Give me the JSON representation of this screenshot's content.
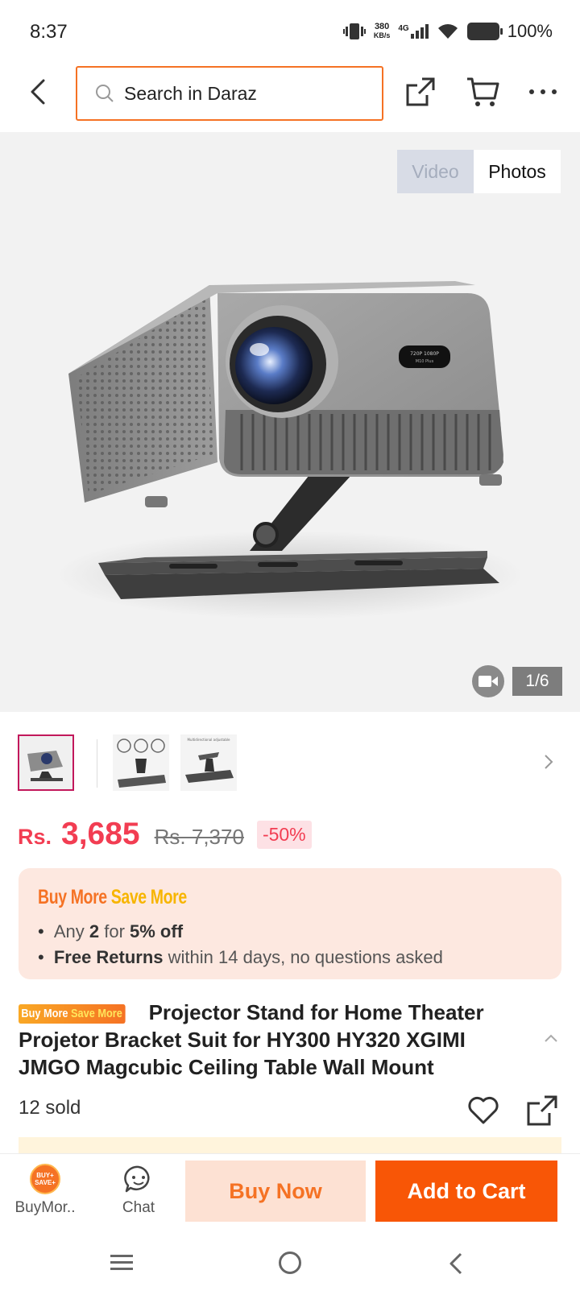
{
  "status_bar": {
    "time": "8:37",
    "net_speed_value": "380",
    "net_speed_unit": "KB/s",
    "network": "4G",
    "battery": "100%"
  },
  "topnav": {
    "search_placeholder": "Search in Daraz"
  },
  "gallery": {
    "tab_video": "Video",
    "tab_photos": "Photos",
    "counter": "1/6",
    "lens_label_line1": "720P 1080P",
    "lens_label_line2": "M10 Plus"
  },
  "thumbnails": {
    "thumb3_caption": "Multidirectional adjustable"
  },
  "price": {
    "currency": "Rs.",
    "current": "3,685",
    "original": "Rs. 7,370",
    "discount": "-50%"
  },
  "promo": {
    "title_buy": "Buy More",
    "title_save": "Save More",
    "line1_pre": "Any ",
    "line1_qty": "2",
    "line1_mid": " for ",
    "line1_off": "5% off",
    "line2_bold": "Free Returns",
    "line2_rest": " within 14 days, no questions asked"
  },
  "product": {
    "tag_buy": "Buy More",
    "tag_save": "Save More",
    "title": "Projector Stand for Home Theater Projetor Bracket Suit for HY300 HY320 XGIMI JMGO Magcubic Ceiling Table Wall Mount",
    "sold": "12 sold"
  },
  "bottom_bar": {
    "buymore_label": "BuyMor..",
    "coin_text": "BUY+ SAVE+",
    "chat_label": "Chat",
    "buy_now": "Buy Now",
    "add_to_cart": "Add to Cart"
  },
  "colors": {
    "brand_orange": "#f85606",
    "price_red": "#f23d52",
    "search_border": "#f57224"
  }
}
